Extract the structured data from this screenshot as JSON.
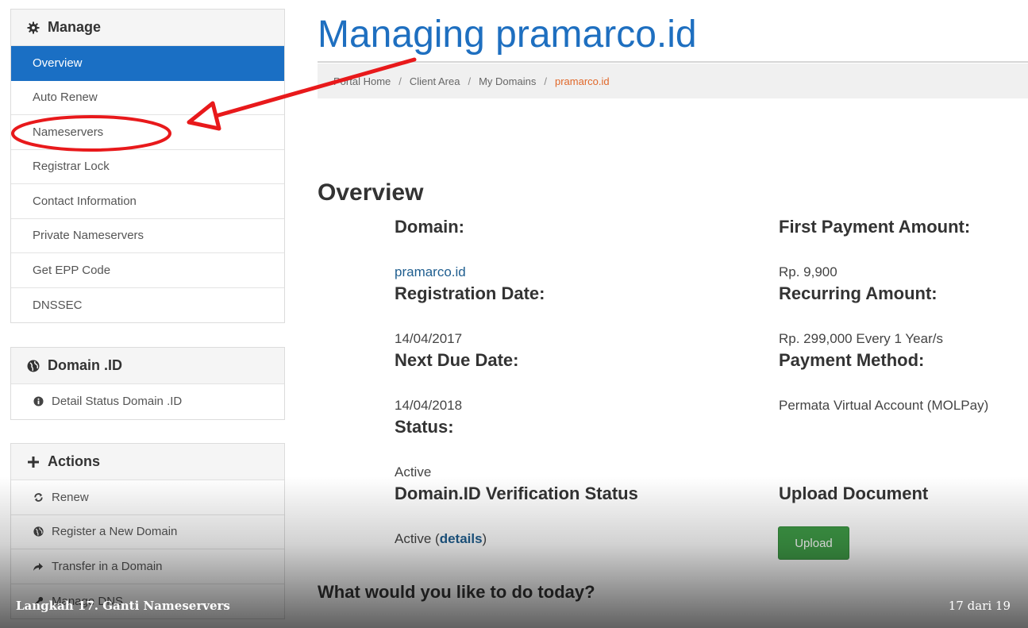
{
  "sidebar": {
    "manage": {
      "title": "Manage",
      "items": [
        "Overview",
        "Auto Renew",
        "Nameservers",
        "Registrar Lock",
        "Contact Information",
        "Private Nameservers",
        "Get EPP Code",
        "DNSSEC"
      ]
    },
    "domain_id": {
      "title": "Domain .ID",
      "items": [
        "Detail Status Domain .ID"
      ]
    },
    "actions": {
      "title": "Actions",
      "items": [
        "Renew",
        "Register a New Domain",
        "Transfer in a Domain",
        "Manage DNS"
      ]
    }
  },
  "main": {
    "title": "Managing pramarco.id",
    "breadcrumb": [
      "Portal Home",
      "Client Area",
      "My Domains",
      "pramarco.id"
    ],
    "overview_heading": "Overview",
    "fields": {
      "domain_label": "Domain:",
      "domain_value": "pramarco.id",
      "registration_label": "Registration Date:",
      "registration_value": "14/04/2017",
      "next_due_label": "Next Due Date:",
      "next_due_value": "14/04/2018",
      "status_label": "Status:",
      "status_value": "Active",
      "verification_label": "Domain.ID Verification Status",
      "verification_value_prefix": "Active (",
      "verification_link": "details",
      "verification_value_suffix": ")",
      "first_payment_label": "First Payment Amount:",
      "first_payment_value": "Rp. 9,900",
      "recurring_label": "Recurring Amount:",
      "recurring_value": "Rp. 299,000 Every 1 Year/s",
      "payment_method_label": "Payment Method:",
      "payment_method_value": "Permata Virtual Account (MOLPay)",
      "upload_label": "Upload Document",
      "upload_button": "Upload"
    },
    "todo_heading": "What would you like to do today?"
  },
  "slide": {
    "caption": "Langkah 17. Ganti Nameservers",
    "page": "17 dari 19"
  },
  "colors": {
    "active_nav": "#1a6fc4",
    "title": "#1e6fc0",
    "breadcrumb_current": "#e0682a",
    "annotation": "#e8191b",
    "upload_button": "#3f9c47"
  }
}
